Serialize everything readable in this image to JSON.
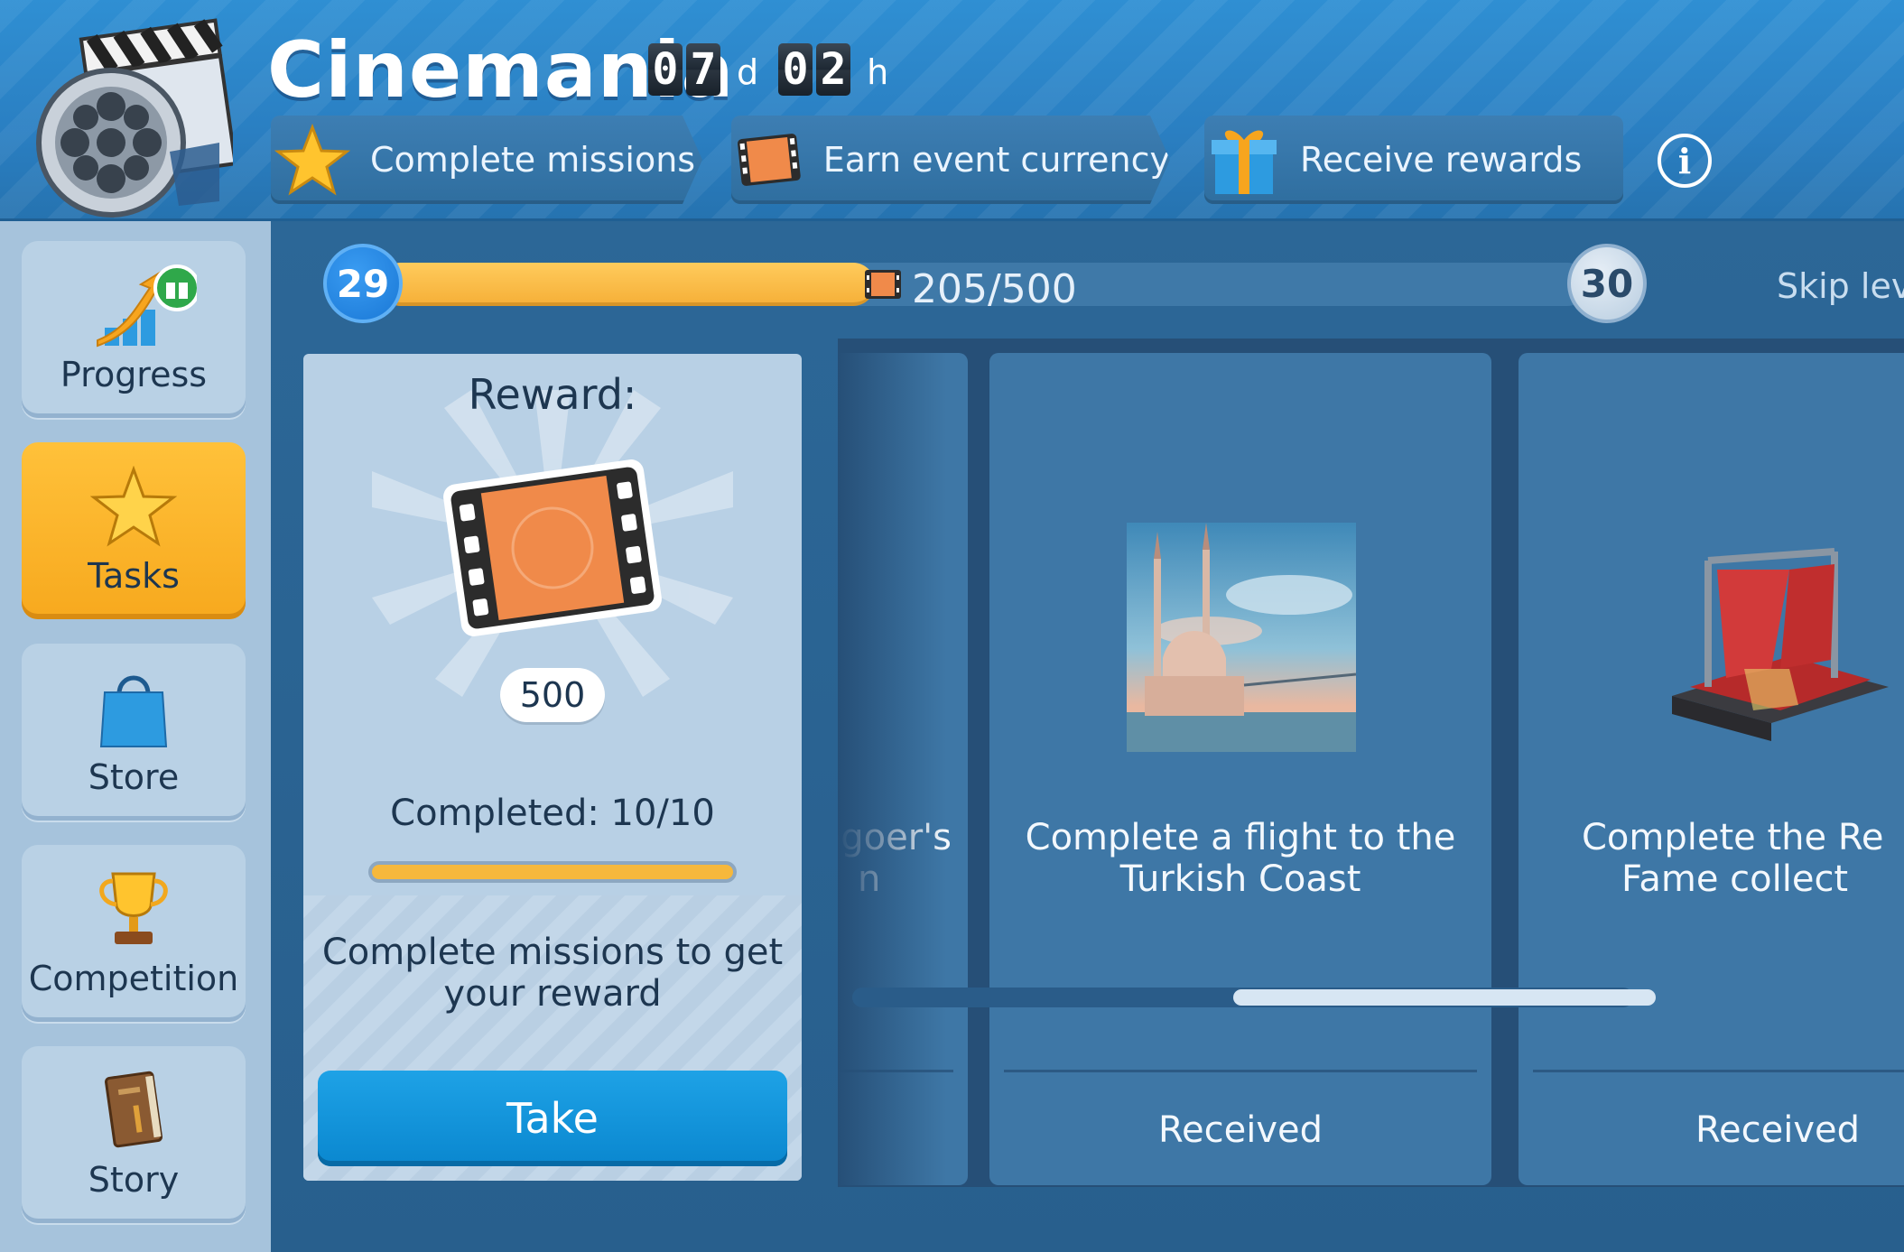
{
  "header": {
    "title": "Cinemania",
    "timer": {
      "days_d1": "0",
      "days_d2": "7",
      "days_unit": "d",
      "hours_d1": "0",
      "hours_d2": "2",
      "hours_unit": "h"
    },
    "steps": [
      {
        "label": "Complete missions",
        "icon": "star-icon"
      },
      {
        "label": "Earn event currency",
        "icon": "film-ticket-icon"
      },
      {
        "label": "Receive rewards",
        "icon": "gift-icon"
      }
    ],
    "info_icon": "i"
  },
  "sidebar": {
    "items": [
      {
        "label": "Progress",
        "icon": "progress-arrow-icon",
        "active": false
      },
      {
        "label": "Tasks",
        "icon": "star-icon",
        "active": true
      },
      {
        "label": "Store",
        "icon": "shopping-bag-icon",
        "active": false
      },
      {
        "label": "Competition",
        "icon": "trophy-icon",
        "active": false
      },
      {
        "label": "Story",
        "icon": "book-icon",
        "active": false
      }
    ]
  },
  "progress": {
    "current_level": "29",
    "next_level": "30",
    "value_text": "205/500",
    "fraction": 0.41,
    "skip_label": "Skip leve"
  },
  "reward": {
    "title": "Reward:",
    "amount": "500",
    "completed_text": "Completed: 10/10",
    "completed_fraction": 1.0,
    "description": "Complete missions to get your reward",
    "take_label": "Take"
  },
  "tasks": [
    {
      "desc_line1": "egoer's",
      "desc_line2": "n",
      "status": ""
    },
    {
      "desc_line1": "Complete a flight to the",
      "desc_line2": "Turkish Coast",
      "status": "Received"
    },
    {
      "desc_line1": "Complete the Re",
      "desc_line2": "Fame collect",
      "status": "Received"
    }
  ],
  "colors": {
    "header_blue": "#2a7fc2",
    "active_tab": "#f7a91e",
    "take_button": "#0a87cf",
    "progress_fill": "#f6b13a"
  }
}
